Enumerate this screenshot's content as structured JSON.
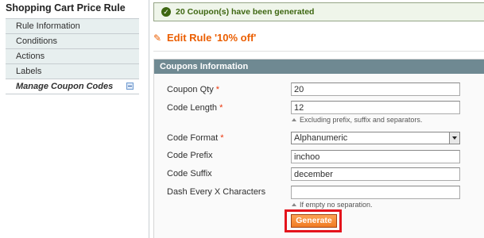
{
  "sidebar": {
    "title": "Shopping Cart Price Rule",
    "tabs": [
      {
        "label": "Rule Information"
      },
      {
        "label": "Conditions"
      },
      {
        "label": "Actions"
      },
      {
        "label": "Labels"
      },
      {
        "label": "Manage Coupon Codes",
        "icon": "collapse-icon"
      }
    ]
  },
  "message": {
    "icon": "success-check-icon",
    "text": "20 Coupon(s) have been generated"
  },
  "page": {
    "icon": "edit-rule-icon",
    "title": "Edit Rule '10% off'"
  },
  "coupons": {
    "header": "Coupons Information",
    "fields": {
      "qty": {
        "label": "Coupon Qty",
        "required": "*",
        "value": "20"
      },
      "length": {
        "label": "Code Length",
        "required": "*",
        "value": "12",
        "note": "Excluding prefix, suffix and separators."
      },
      "format": {
        "label": "Code Format",
        "required": "*",
        "value": "Alphanumeric"
      },
      "prefix": {
        "label": "Code Prefix",
        "value": "inchoo"
      },
      "suffix": {
        "label": "Code Suffix",
        "value": "december"
      },
      "dash": {
        "label": "Dash Every X Characters",
        "value": "",
        "note": "If empty no separation."
      }
    },
    "generate_label": "Generate"
  },
  "colors": {
    "accent": "#eb5e00",
    "success": "#3d6611",
    "header_bg": "#6f8992",
    "highlight": "#e4131c"
  }
}
